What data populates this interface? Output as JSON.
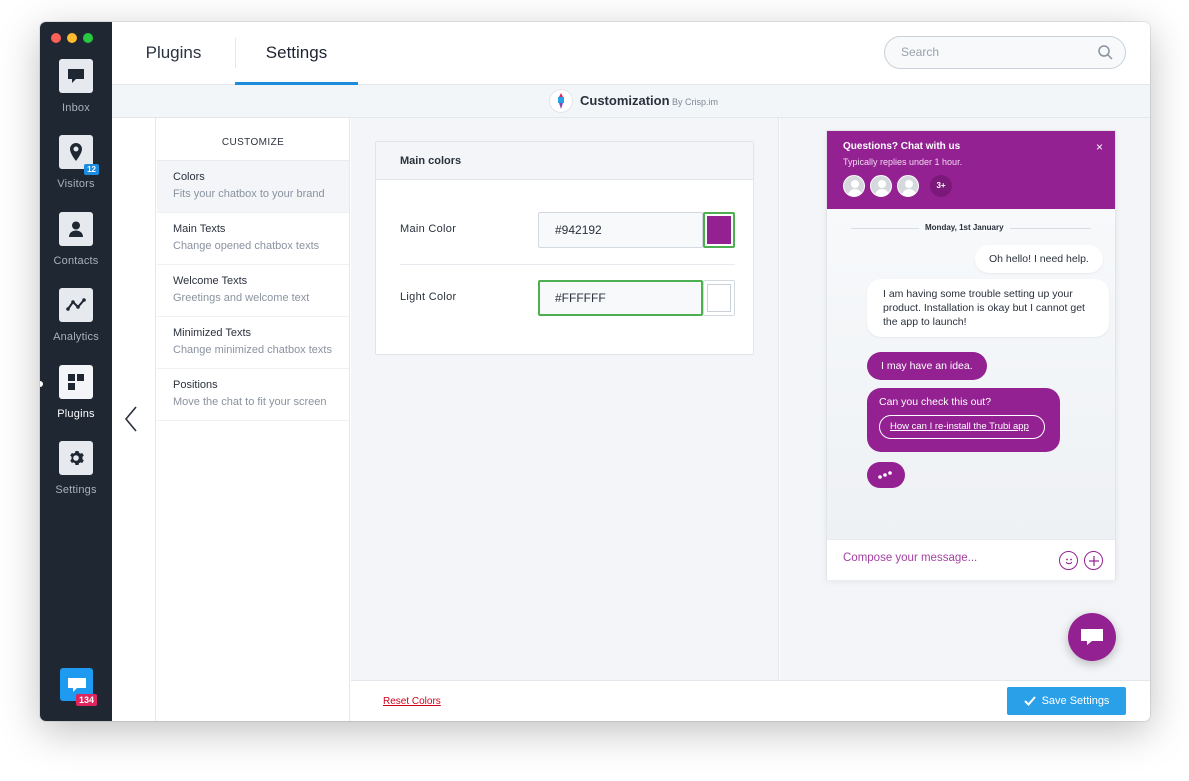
{
  "sidebar": {
    "items": [
      {
        "label": "Inbox",
        "icon": "inbox-icon"
      },
      {
        "label": "Visitors",
        "icon": "map-pin-icon",
        "badge": "12"
      },
      {
        "label": "Contacts",
        "icon": "person-icon"
      },
      {
        "label": "Analytics",
        "icon": "analytics-icon"
      },
      {
        "label": "Plugins",
        "icon": "plugins-icon",
        "active": true
      },
      {
        "label": "Settings",
        "icon": "gear-icon"
      }
    ],
    "app_badge": "134"
  },
  "topbar": {
    "tabs": [
      {
        "label": "Plugins"
      },
      {
        "label": "Settings",
        "active": true
      }
    ],
    "search": {
      "placeholder": "Search"
    }
  },
  "plugin": {
    "name": "Customization",
    "author": "By Crisp.im"
  },
  "menu": {
    "title": "CUSTOMIZE",
    "items": [
      {
        "title": "Colors",
        "desc": "Fits your chatbox to your brand",
        "active": true
      },
      {
        "title": "Main Texts",
        "desc": "Change opened chatbox texts"
      },
      {
        "title": "Welcome Texts",
        "desc": "Greetings and welcome text"
      },
      {
        "title": "Minimized Texts",
        "desc": "Change minimized chatbox texts"
      },
      {
        "title": "Positions",
        "desc": "Move the chat to fit your screen"
      }
    ]
  },
  "colors_card": {
    "title": "Main colors",
    "main_color": {
      "label": "Main Color",
      "value": "#942192"
    },
    "light_color": {
      "label": "Light Color",
      "value": "#FFFFFF"
    }
  },
  "footer": {
    "reset_label": "Reset Colors",
    "save_label": "Save Settings"
  },
  "preview": {
    "header_title": "Questions? Chat with us",
    "header_subtitle": "Typically replies under 1 hour.",
    "close": "×",
    "avatars_more": "3+",
    "date": "Monday, 1st January",
    "messages": [
      {
        "from": "visitor",
        "text": "Oh hello! I need help."
      },
      {
        "from": "visitor",
        "text": "I am having some trouble setting up your product. Installation is okay but I cannot get the app to launch!"
      },
      {
        "from": "operator",
        "text": "I may have an idea."
      },
      {
        "from": "operator",
        "text": "Can you check this out?",
        "link": "How can I re-install the Trubi app"
      }
    ],
    "compose_placeholder": "Compose your message..."
  },
  "colors": {
    "brand": "#942192",
    "accent": "#2aa0e8",
    "sidebar_bg": "#1f2733",
    "focus": "#4caf50",
    "danger": "#d0021b"
  }
}
